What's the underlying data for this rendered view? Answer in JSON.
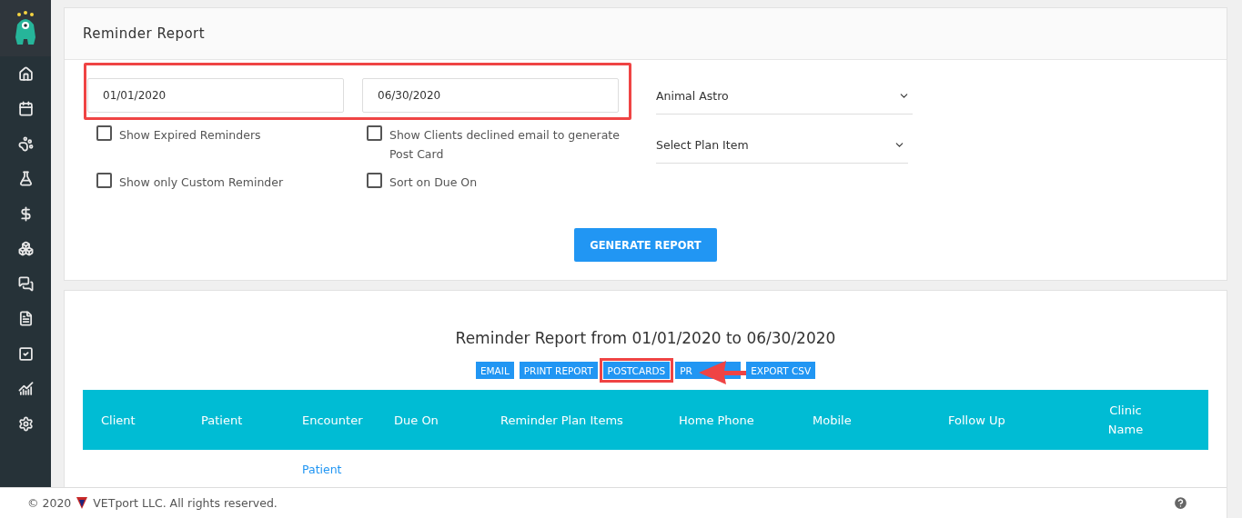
{
  "filter_card": {
    "title": "Reminder Report",
    "start_date": {
      "value": "01/01/2020"
    },
    "end_date": {
      "value": "06/30/2020"
    },
    "checkboxes": [
      {
        "label": "Show Expired Reminders",
        "checked": false
      },
      {
        "label": "Show Clients declined email to generate Post Card",
        "checked": false
      },
      {
        "label": "Show only Custom Reminder",
        "checked": false
      },
      {
        "label": "Sort on Due On",
        "checked": false
      }
    ],
    "selects": [
      {
        "value": "Animal Astro"
      },
      {
        "value": "Select Plan Item"
      }
    ],
    "generate_button": "GENERATE REPORT"
  },
  "report_card": {
    "heading": "Reminder Report from 01/01/2020 to 06/30/2020",
    "actions": [
      {
        "label": "EMAIL",
        "highlighted": false
      },
      {
        "label": "PRINT REPORT",
        "highlighted": false
      },
      {
        "label": "POSTCARDS",
        "highlighted": true
      },
      {
        "label": "PR",
        "highlighted": false
      },
      {
        "label": "EXPORT CSV",
        "highlighted": false
      }
    ],
    "table": {
      "columns": [
        "Client",
        "Patient",
        "Encounter",
        "Due On",
        "Reminder Plan Items",
        "Home Phone",
        "Mobile",
        "Follow Up",
        "Clinic Name"
      ],
      "rows": [
        {
          "encounter": "Patient"
        }
      ]
    }
  },
  "footer": {
    "copyright": "© 2020",
    "company": "VETport LLC. All rights reserved."
  }
}
